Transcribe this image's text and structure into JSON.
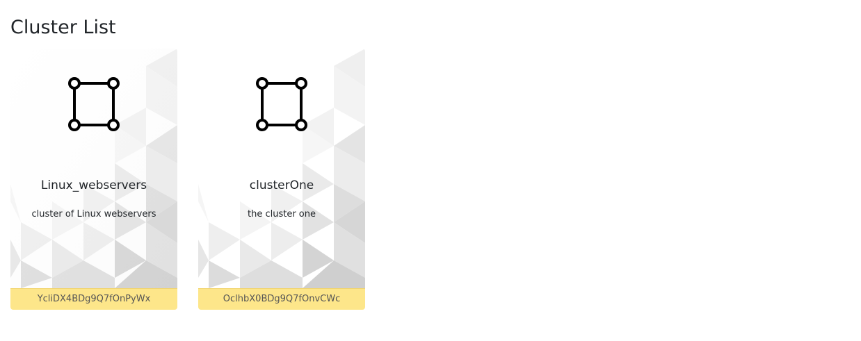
{
  "page": {
    "title": "Cluster List"
  },
  "clusters": [
    {
      "name": "Linux_webservers",
      "description": "cluster of Linux webservers",
      "id": "YcliDX4BDg9Q7fOnPyWx",
      "icon": "cluster-square-icon"
    },
    {
      "name": "clusterOne",
      "description": "the cluster one",
      "id": "OclhbX0BDg9Q7fOnvCWc",
      "icon": "cluster-square-icon"
    }
  ],
  "colors": {
    "footer_bg": "#fde68a",
    "icon_stroke": "#000000"
  }
}
